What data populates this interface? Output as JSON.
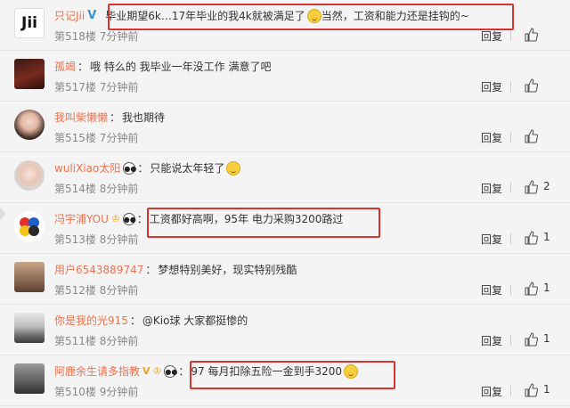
{
  "comments": [
    {
      "user": "只记Jii",
      "badges": [
        "v",
        "emoji"
      ],
      "text": "毕业期望6k…17年毕业的我4k就被满足了",
      "text2": "当然，工资和能力还是挂钩的~",
      "floor": "第518楼",
      "time": "7分钟前",
      "reply": "回复",
      "likes": "",
      "avatar": "Jii"
    },
    {
      "user": "孤竭",
      "badges": [],
      "text": "哦 特么的 我毕业一年没工作 满意了吧",
      "text2": "",
      "floor": "第517楼",
      "time": "7分钟前",
      "reply": "回复",
      "likes": "",
      "avatar": ""
    },
    {
      "user": "我叫柴懒懒",
      "badges": [],
      "text": "我也期待",
      "text2": "",
      "floor": "第515楼",
      "time": "7分钟前",
      "reply": "回复",
      "likes": "",
      "avatar": ""
    },
    {
      "user": "wuliXiao太阳",
      "badges": [
        "panda"
      ],
      "text": "只能说太年轻了",
      "text2": "",
      "floor": "第514楼",
      "time": "8分钟前",
      "reply": "回复",
      "likes": "2",
      "avatar": ""
    },
    {
      "user": "冯宇浦YOU",
      "badges": [
        "vip",
        "panda"
      ],
      "text": "工资都好高啊，95年 电力采购3200路过",
      "text2": "",
      "floor": "第513楼",
      "time": "8分钟前",
      "reply": "回复",
      "likes": "1",
      "avatar": ""
    },
    {
      "user": "用户6543889747",
      "badges": [],
      "text": "梦想特别美好，现实特别残酷",
      "text2": "",
      "floor": "第512楼",
      "time": "8分钟前",
      "reply": "回复",
      "likes": "1",
      "avatar": ""
    },
    {
      "user": "你是我的光915",
      "badges": [],
      "text": "@Kio球 大家都挺惨的",
      "text2": "",
      "floor": "第511楼",
      "time": "8分钟前",
      "reply": "回复",
      "likes": "1",
      "avatar": ""
    },
    {
      "user": "阿鹿余生请多指教",
      "badges": [
        "v",
        "vip",
        "panda"
      ],
      "text": "97 每月扣除五险一金到手3200",
      "text2": "",
      "floor": "第510楼",
      "time": "9分钟前",
      "reply": "回复",
      "likes": "1",
      "avatar": ""
    }
  ],
  "colors": {
    "username": "#eb7350",
    "highlight": "#d9332e",
    "verified": "#3f91d6"
  }
}
